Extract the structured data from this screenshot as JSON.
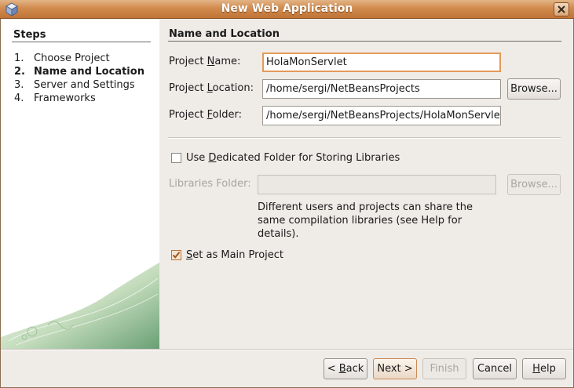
{
  "window": {
    "title": "New Web Application",
    "app_icon": "netbeans-cube-icon",
    "close_icon": "close-icon",
    "border_color": "#8a6d4e",
    "titlebar_color": "#d28b4e"
  },
  "steps": {
    "heading": "Steps",
    "items": [
      {
        "num": "1.",
        "label": "Choose Project",
        "current": false
      },
      {
        "num": "2.",
        "label": "Name and Location",
        "current": true
      },
      {
        "num": "3.",
        "label": "Server and Settings",
        "current": false
      },
      {
        "num": "4.",
        "label": "Frameworks",
        "current": false
      }
    ]
  },
  "panel": {
    "heading": "Name and Location",
    "project_name": {
      "label_pre": "Project ",
      "label_mn": "N",
      "label_post": "ame:",
      "value": "HolaMonServlet"
    },
    "project_location": {
      "label_pre": "Project ",
      "label_mn": "L",
      "label_post": "ocation:",
      "value": "/home/sergi/NetBeansProjects",
      "browse": "Browse..."
    },
    "project_folder": {
      "label_pre": "Project ",
      "label_mn": "F",
      "label_post": "older:",
      "value": "/home/sergi/NetBeansProjects/HolaMonServlet"
    },
    "dedicated_folder": {
      "label_pre": "Use ",
      "label_mn": "D",
      "label_post": "edicated Folder for Storing Libraries",
      "checked": false
    },
    "libraries_folder": {
      "label": "Libraries Folder:",
      "value": "",
      "browse": "Browse..."
    },
    "help_text": "Different users and projects can share the same compilation libraries (see Help for details).",
    "main_project": {
      "label_mn": "S",
      "label_post": "et as Main Project",
      "checked": true
    }
  },
  "buttons": {
    "back_pre": "< ",
    "back_mn": "B",
    "back_post": "ack",
    "next": "Next >",
    "finish": "Finish",
    "cancel": "Cancel",
    "help_mn": "H",
    "help_post": "elp"
  },
  "colors": {
    "accent": "#e39a58",
    "steps_background": "#ffffff",
    "dialog_background": "#efebe7"
  }
}
